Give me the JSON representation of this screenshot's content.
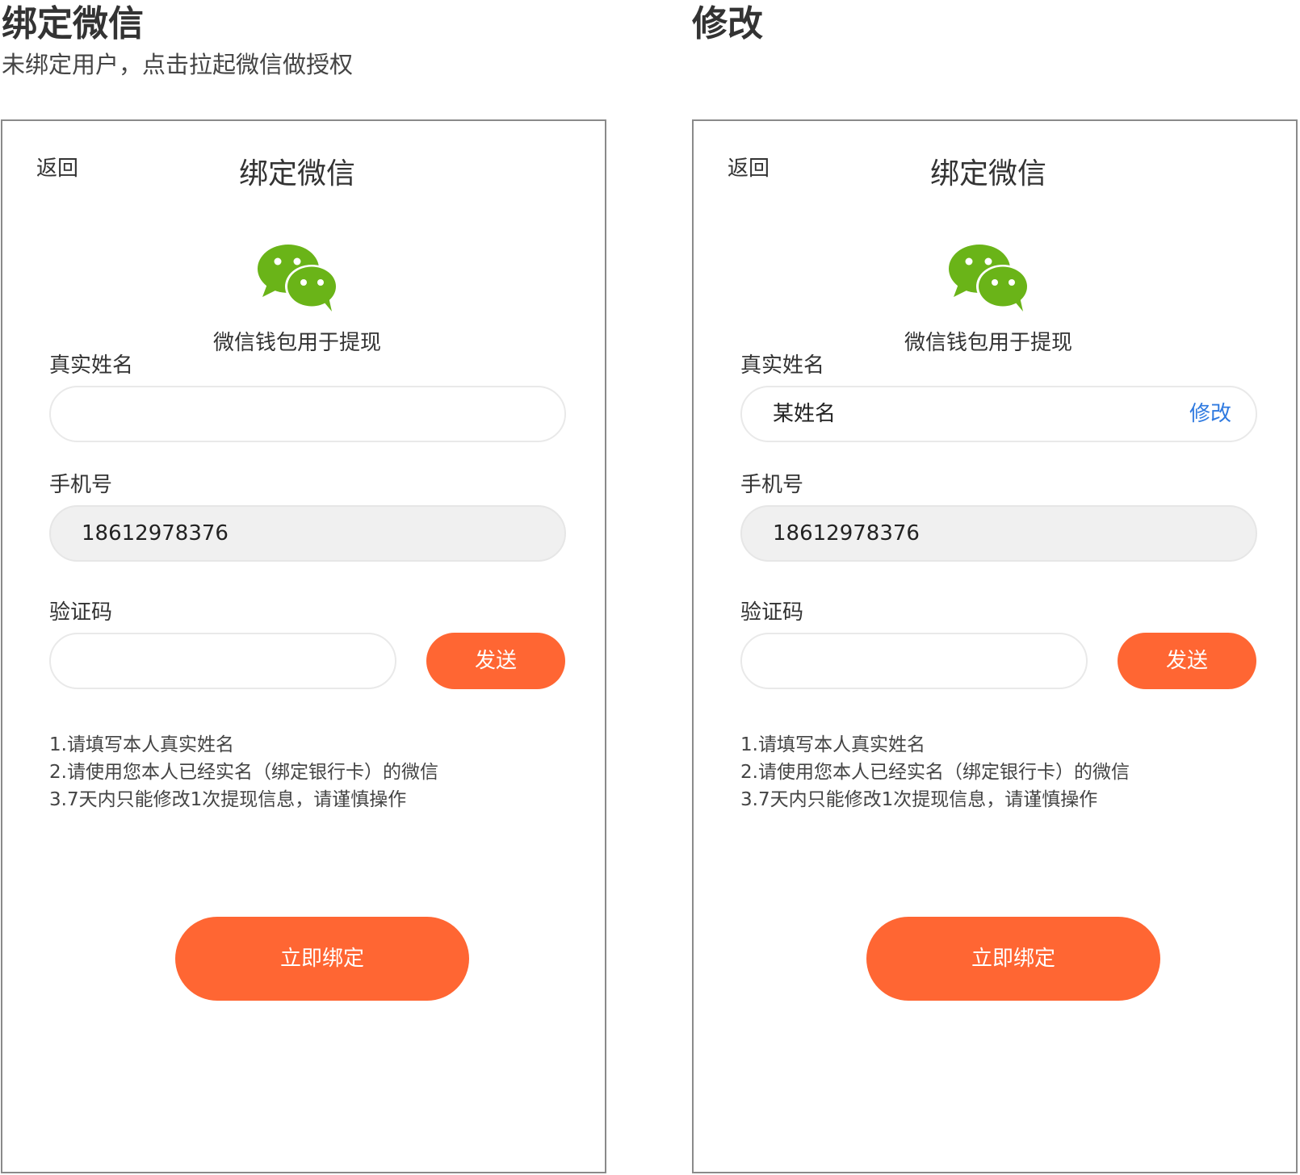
{
  "left_section": {
    "title": "绑定微信",
    "subtitle": "未绑定用户，点击拉起微信做授权"
  },
  "right_section": {
    "title": "修改"
  },
  "screens": [
    {
      "back_label": "返回",
      "nav_title": "绑定微信",
      "wechat_caption": "微信钱包用于提现",
      "name_label": "真实姓名",
      "name_value": "",
      "phone_label": "手机号",
      "phone_value": "18612978376",
      "code_label": "验证码",
      "code_value": "",
      "send_label": "发送",
      "notes": [
        "1.请填写本人真实姓名",
        "2.请使用您本人已经实名（绑定银行卡）的微信",
        "3.7天内只能修改1次提现信息，请谨慎操作"
      ],
      "bind_label": "立即绑定"
    },
    {
      "back_label": "返回",
      "nav_title": "绑定微信",
      "wechat_caption": "微信钱包用于提现",
      "name_label": "真实姓名",
      "name_value": "某姓名",
      "name_edit_label": "修改",
      "phone_label": "手机号",
      "phone_value": "18612978376",
      "code_label": "验证码",
      "code_value": "",
      "send_label": "发送",
      "notes": [
        "1.请填写本人真实姓名",
        "2.请使用您本人已经实名（绑定银行卡）的微信",
        "3.7天内只能修改1次提现信息，请谨慎操作"
      ],
      "bind_label": "立即绑定"
    }
  ],
  "colors": {
    "accent": "#ff6633",
    "wechat_green": "#6ab418",
    "link_blue": "#2f7ae0",
    "filled_input_bg": "#f0f0f0"
  },
  "icons": {
    "logo": "wechat-logo-icon"
  }
}
